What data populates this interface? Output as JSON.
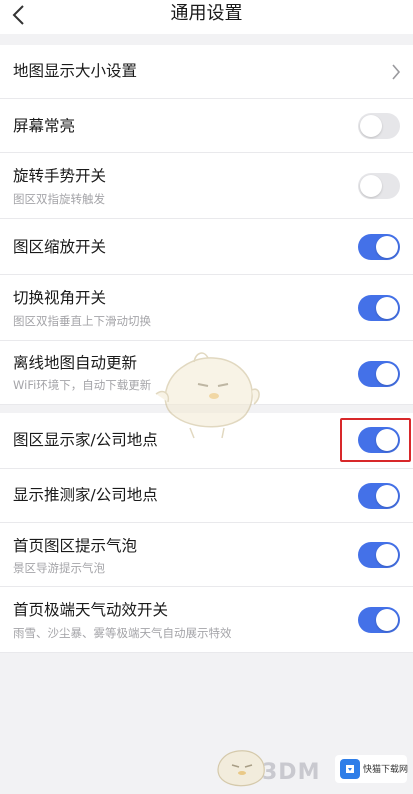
{
  "header": {
    "title": "通用设置",
    "back_icon": "chevron-left-icon"
  },
  "colors": {
    "accent": "#4471e8",
    "toggle_off": "#e6e6e9",
    "highlight": "#d8282a"
  },
  "settings": [
    {
      "label": "地图显示大小设置",
      "control": "chevron"
    },
    {
      "label": "屏幕常亮",
      "control": "toggle",
      "on": false
    },
    {
      "label": "旋转手势开关",
      "sub": "图区双指旋转触发",
      "control": "toggle",
      "on": false
    },
    {
      "label": "图区缩放开关",
      "control": "toggle",
      "on": true
    },
    {
      "label": "切换视角开关",
      "sub": "图区双指垂直上下滑动切换",
      "control": "toggle",
      "on": true
    },
    {
      "label": "离线地图自动更新",
      "sub": "WiFi环境下，自动下载更新",
      "control": "toggle",
      "on": true
    },
    {
      "label": "图区显示家/公司地点",
      "control": "toggle",
      "on": true,
      "highlighted": true
    },
    {
      "label": "显示推测家/公司地点",
      "control": "toggle",
      "on": true
    },
    {
      "label": "首页图区提示气泡",
      "sub": "景区导游提示气泡",
      "control": "toggle",
      "on": true
    },
    {
      "label": "首页极端天气动效开关",
      "sub": "雨雪、沙尘暴、雾等极端天气自动展示特效",
      "control": "toggle",
      "on": true
    }
  ],
  "watermark": {
    "text": "3DM",
    "badge_text": "快猫下载网"
  }
}
